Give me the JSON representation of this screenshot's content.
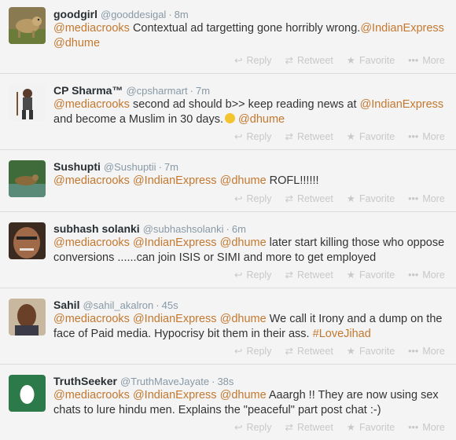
{
  "actions": {
    "reply": "Reply",
    "retweet": "Retweet",
    "favorite": "Favorite",
    "more": "More"
  },
  "tweets": [
    {
      "name": "goodgirl",
      "handle": "@gooddesigal",
      "time": "8m",
      "text": [
        {
          "t": "@mediacrooks",
          "mention": true
        },
        {
          "t": " Contextual ad targetting gone horribly wrong."
        },
        {
          "t": "@IndianExpress",
          "mention": true
        },
        {
          "t": " "
        },
        {
          "t": "@dhume",
          "mention": true
        }
      ]
    },
    {
      "name": "CP Sharma™",
      "handle": "@cpsharmart",
      "time": "7m",
      "text": [
        {
          "t": "@mediacrooks",
          "mention": true
        },
        {
          "t": " second ad should b>> keep reading news  at "
        },
        {
          "t": "@IndianExpress",
          "mention": true
        },
        {
          "t": " and become a Muslim in 30 days."
        },
        {
          "t": "",
          "emoji": true
        },
        {
          "t": "  "
        },
        {
          "t": "@dhume",
          "mention": true
        }
      ]
    },
    {
      "name": "Sushupti",
      "handle": "@Sushuptii",
      "time": "7m",
      "text": [
        {
          "t": "@mediacrooks",
          "mention": true
        },
        {
          "t": " "
        },
        {
          "t": "@IndianExpress",
          "mention": true
        },
        {
          "t": " "
        },
        {
          "t": "@dhume",
          "mention": true
        },
        {
          "t": "  ROFL!!!!!!"
        }
      ]
    },
    {
      "name": "subhash solanki",
      "handle": "@subhashsolanki",
      "time": "6m",
      "text": [
        {
          "t": "@mediacrooks",
          "mention": true
        },
        {
          "t": " "
        },
        {
          "t": "@IndianExpress",
          "mention": true
        },
        {
          "t": " "
        },
        {
          "t": "@dhume",
          "mention": true
        },
        {
          "t": " later start  killing those who oppose conversions ......can join ISIS or SIMI and more to get employed"
        }
      ]
    },
    {
      "name": "Sahil",
      "handle": "@sahil_akalron",
      "time": "45s",
      "text": [
        {
          "t": "@mediacrooks",
          "mention": true
        },
        {
          "t": " "
        },
        {
          "t": "@IndianExpress",
          "mention": true
        },
        {
          "t": " "
        },
        {
          "t": "@dhume",
          "mention": true
        },
        {
          "t": " We call it Irony and a dump on the face of Paid media. Hypocrisy bit them in their ass. "
        },
        {
          "t": "#LoveJihad",
          "mention": true
        }
      ]
    },
    {
      "name": "TruthSeeker",
      "handle": "@TruthMaveJayate",
      "time": "38s",
      "text": [
        {
          "t": "@mediacrooks",
          "mention": true
        },
        {
          "t": " "
        },
        {
          "t": "@IndianExpress",
          "mention": true
        },
        {
          "t": " "
        },
        {
          "t": "@dhume",
          "mention": true
        },
        {
          "t": " Aaargh !! They are now using sex chats to lure hindu men. Explains the \"peaceful\" part post chat :-)"
        }
      ]
    }
  ]
}
